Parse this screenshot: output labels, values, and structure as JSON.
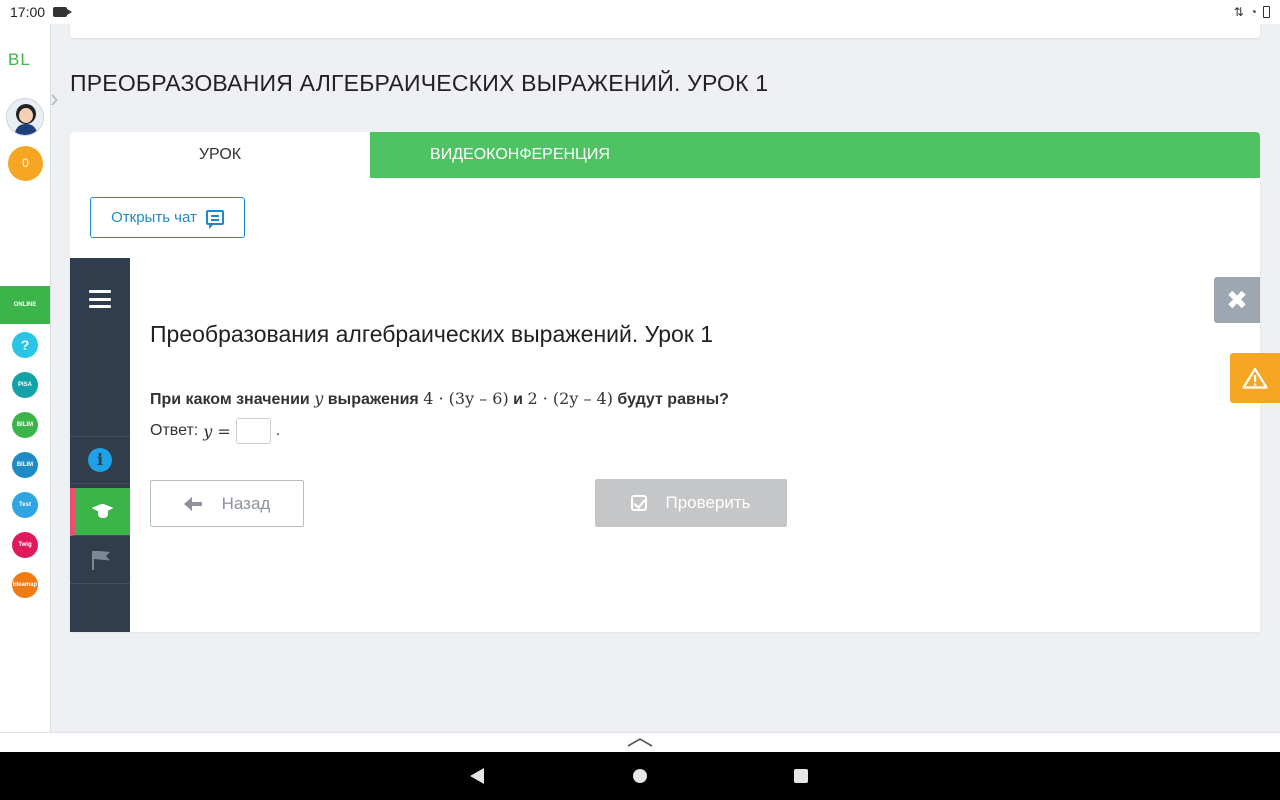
{
  "status_bar": {
    "time": "17:00"
  },
  "sidebar": {
    "logo": "BL",
    "coins": "0",
    "apps": [
      {
        "label": "ONLINE MENTOR",
        "color": "#3bb54a"
      },
      {
        "label": "?",
        "color": "#29c5e6"
      },
      {
        "label": "PISA",
        "color": "#12a2a8"
      },
      {
        "label": "BILIM Land",
        "color": "#3bb54a"
      },
      {
        "label": "BILIM Book",
        "color": "#1f8bc4"
      },
      {
        "label": "Test",
        "color": "#2ea4e0"
      },
      {
        "label": "Twig",
        "color": "#e0195e"
      },
      {
        "label": "Ideamap",
        "color": "#f07b12"
      }
    ]
  },
  "page": {
    "title": "ПРЕОБРАЗОВАНИЯ АЛГЕБРАИЧЕСКИХ ВЫРАЖЕНИЙ. УРОК 1",
    "tabs": [
      {
        "label": "УРОК",
        "active": true
      },
      {
        "label": "ВИДЕОКОНФЕРЕНЦИЯ",
        "active": false
      }
    ],
    "chat_button": "Открыть чат"
  },
  "lesson": {
    "title": "Преобразования алгебраических выражений. Урок 1",
    "question": {
      "prefix": "При каком значении",
      "variable": "y",
      "middle": "выражения",
      "expr1": "4 · (3y – 6)",
      "conj": "и",
      "expr2": "2 · (2y – 4)",
      "suffix": "будут равны?"
    },
    "answer_label": "Ответ:",
    "answer_var": "y =",
    "answer_value": "",
    "answer_end": ".",
    "back_button": "Назад",
    "check_button": "Проверить"
  },
  "colors": {
    "accent_green": "#4fc263",
    "nav_dark": "#2f3d4c",
    "link_blue": "#1f8bc4",
    "warning_orange": "#f5a623"
  }
}
